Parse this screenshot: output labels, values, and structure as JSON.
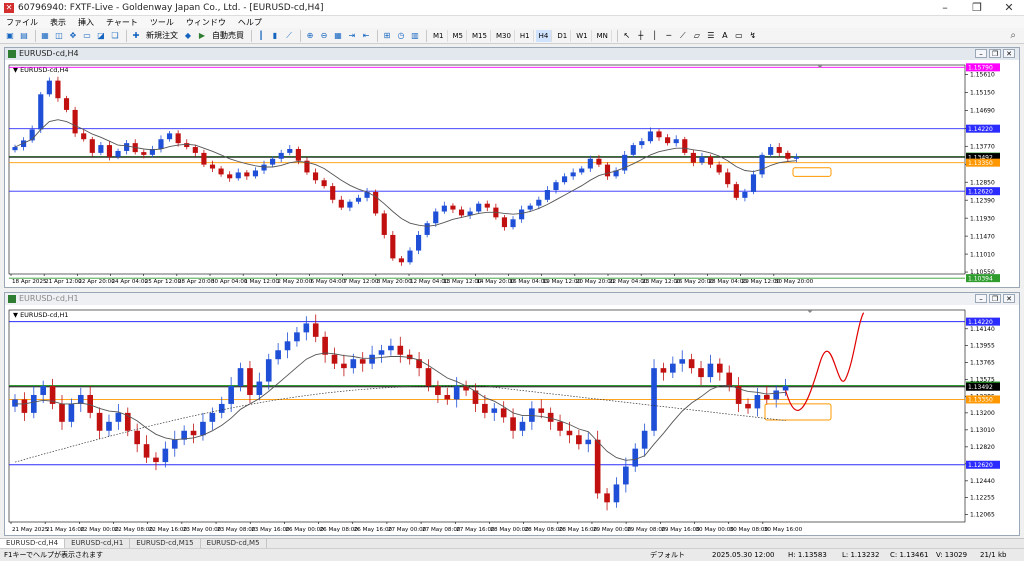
{
  "window": {
    "title": "60796940: FXTF-Live - Goldenway Japan Co., Ltd. - [EURUSD-cd,H4]"
  },
  "menu": [
    "ファイル",
    "表示",
    "挿入",
    "チャート",
    "ツール",
    "ウィンドウ",
    "ヘルプ"
  ],
  "toolbar": {
    "new_order": "新規注文",
    "auto_trade": "自動売買",
    "timeframes": [
      "M1",
      "M5",
      "M15",
      "M30",
      "H1",
      "H4",
      "D1",
      "W1",
      "MN"
    ],
    "active_timeframe": "H4"
  },
  "chart_h4": {
    "window_title": "EURUSD-cd,H4",
    "label": "EURUSD-cd,H4",
    "chart_data": {
      "type": "candlestick",
      "symbol": "EURUSD-cd",
      "timeframe": "H4",
      "ylim": [
        1.105,
        1.1585
      ],
      "yticks": [
        1.1561,
        1.1515,
        1.1469,
        1.1423,
        1.1377,
        1.1331,
        1.1285,
        1.1239,
        1.1193,
        1.1147,
        1.1101,
        1.1055
      ],
      "xticks": [
        "18 Apr 2025",
        "21 Apr 12:00",
        "22 Apr 20:00",
        "24 Apr 04:00",
        "25 Apr 12:00",
        "28 Apr 20:00",
        "30 Apr 04:00",
        "1 May 12:00",
        "2 May 20:00",
        "6 May 04:00",
        "7 May 12:00",
        "8 May 20:00",
        "12 May 04:00",
        "13 May 12:00",
        "14 May 20:00",
        "16 May 04:00",
        "19 May 12:00",
        "20 May 20:00",
        "22 May 04:00",
        "23 May 12:00",
        "26 May 20:00",
        "28 May 04:00",
        "29 May 12:00",
        "30 May 20:00"
      ],
      "closes": [
        1.1375,
        1.1392,
        1.142,
        1.151,
        1.1545,
        1.15,
        1.147,
        1.141,
        1.1395,
        1.136,
        1.138,
        1.135,
        1.1365,
        1.1385,
        1.1362,
        1.1355,
        1.137,
        1.1395,
        1.141,
        1.1385,
        1.1375,
        1.136,
        1.133,
        1.132,
        1.1305,
        1.1295,
        1.131,
        1.13,
        1.1315,
        1.133,
        1.1345,
        1.136,
        1.137,
        1.134,
        1.131,
        1.129,
        1.1275,
        1.124,
        1.122,
        1.1235,
        1.1245,
        1.126,
        1.1205,
        1.115,
        1.109,
        1.108,
        1.111,
        1.115,
        1.118,
        1.121,
        1.1225,
        1.1215,
        1.12,
        1.121,
        1.123,
        1.122,
        1.1195,
        1.117,
        1.119,
        1.1215,
        1.1225,
        1.124,
        1.1265,
        1.1285,
        1.13,
        1.131,
        1.132,
        1.1345,
        1.133,
        1.13,
        1.1315,
        1.1355,
        1.138,
        1.139,
        1.1415,
        1.14,
        1.1385,
        1.1395,
        1.136,
        1.1335,
        1.135,
        1.133,
        1.131,
        1.128,
        1.1245,
        1.126,
        1.1305,
        1.1355,
        1.1375,
        1.136,
        1.1345,
        1.135
      ],
      "moving_average": [
        1.1375,
        1.1385,
        1.1395,
        1.142,
        1.144,
        1.1445,
        1.144,
        1.143,
        1.142,
        1.1408,
        1.14,
        1.139,
        1.138,
        1.1378,
        1.1374,
        1.137,
        1.1368,
        1.137,
        1.1376,
        1.138,
        1.1382,
        1.138,
        1.1372,
        1.1364,
        1.1355,
        1.1345,
        1.1338,
        1.1332,
        1.1327,
        1.1324,
        1.1324,
        1.1328,
        1.1335,
        1.1338,
        1.1336,
        1.133,
        1.132,
        1.1305,
        1.129,
        1.1277,
        1.1267,
        1.126,
        1.1248,
        1.123,
        1.121,
        1.1192,
        1.118,
        1.1175,
        1.1172,
        1.1175,
        1.1182,
        1.119,
        1.1195,
        1.12,
        1.1205,
        1.1208,
        1.1208,
        1.1205,
        1.1203,
        1.1205,
        1.121,
        1.1218,
        1.1228,
        1.124,
        1.1252,
        1.1264,
        1.1276,
        1.129,
        1.1302,
        1.1308,
        1.1314,
        1.1322,
        1.1332,
        1.1343,
        1.1355,
        1.1363,
        1.1368,
        1.1372,
        1.1372,
        1.1368,
        1.1365,
        1.136,
        1.1352,
        1.134,
        1.1325,
        1.1315,
        1.1312,
        1.1318,
        1.1328,
        1.1335,
        1.1338,
        1.134
      ],
      "hlines": [
        {
          "value": 1.1579,
          "color": "#ff00ff",
          "label": "1.15790"
        },
        {
          "value": 1.1422,
          "color": "#2b2bff",
          "label": "1.14220"
        },
        {
          "value": 1.13506,
          "color": "#2e9d2e",
          "label": "1.13506"
        },
        {
          "value": 1.13492,
          "color": "#000000",
          "label": "1.13492"
        },
        {
          "value": 1.1335,
          "color": "#ff9800",
          "label": "1.13350"
        },
        {
          "value": 1.1262,
          "color": "#2b2bff",
          "label": "1.12620"
        },
        {
          "value": 1.10394,
          "color": "#2e9d2e",
          "label": "1.10394"
        }
      ],
      "colors": {
        "bull": "#1f4fd6",
        "bear": "#c01010",
        "ma": "#555555",
        "zone": "#ff9800"
      }
    }
  },
  "chart_h1": {
    "window_title": "EURUSD-cd,H1",
    "label": "EURUSD-cd,H1",
    "chart_data": {
      "type": "candlestick",
      "symbol": "EURUSD-cd",
      "timeframe": "H1",
      "ylim": [
        1.1198,
        1.1435
      ],
      "yticks": [
        1.1414,
        1.13955,
        1.13765,
        1.13575,
        1.13385,
        1.132,
        1.1301,
        1.1282,
        1.1263,
        1.1244,
        1.12255,
        1.12065
      ],
      "xticks": [
        "21 May 2025",
        "21 May 16:00",
        "22 May 00:00",
        "22 May 08:00",
        "22 May 16:00",
        "23 May 00:00",
        "23 May 08:00",
        "23 May 16:00",
        "26 May 00:00",
        "26 May 08:00",
        "26 May 16:00",
        "27 May 00:00",
        "27 May 08:00",
        "27 May 16:00",
        "28 May 00:00",
        "28 May 08:00",
        "28 May 16:00",
        "29 May 00:00",
        "29 May 08:00",
        "29 May 16:00",
        "30 May 00:00",
        "30 May 08:00",
        "30 May 16:00"
      ],
      "closes": [
        1.1335,
        1.132,
        1.134,
        1.135,
        1.133,
        1.131,
        1.133,
        1.134,
        1.132,
        1.13,
        1.131,
        1.132,
        1.13,
        1.1285,
        1.127,
        1.1265,
        1.128,
        1.129,
        1.13,
        1.1295,
        1.131,
        1.132,
        1.133,
        1.135,
        1.137,
        1.134,
        1.1355,
        1.138,
        1.139,
        1.14,
        1.141,
        1.142,
        1.1405,
        1.1385,
        1.1375,
        1.137,
        1.138,
        1.1375,
        1.1385,
        1.139,
        1.1395,
        1.1385,
        1.138,
        1.137,
        1.135,
        1.134,
        1.1335,
        1.135,
        1.1345,
        1.133,
        1.132,
        1.1325,
        1.1315,
        1.13,
        1.131,
        1.1325,
        1.132,
        1.131,
        1.13,
        1.1295,
        1.1285,
        1.129,
        1.123,
        1.122,
        1.124,
        1.126,
        1.128,
        1.13,
        1.137,
        1.1365,
        1.1375,
        1.138,
        1.137,
        1.136,
        1.1375,
        1.1365,
        1.135,
        1.133,
        1.1325,
        1.134,
        1.1335,
        1.1345,
        1.135
      ],
      "moving_average": [
        1.133,
        1.133,
        1.1332,
        1.1334,
        1.1333,
        1.133,
        1.133,
        1.1331,
        1.1329,
        1.1325,
        1.1322,
        1.1321,
        1.1317,
        1.1311,
        1.1303,
        1.1296,
        1.1292,
        1.129,
        1.1291,
        1.1292,
        1.1295,
        1.13,
        1.1306,
        1.1314,
        1.1324,
        1.133,
        1.1336,
        1.1344,
        1.1353,
        1.1362,
        1.1371,
        1.138,
        1.1385,
        1.1387,
        1.1386,
        1.1384,
        1.1383,
        1.1381,
        1.1381,
        1.1382,
        1.1383,
        1.1383,
        1.1382,
        1.1379,
        1.1373,
        1.1366,
        1.1359,
        1.1355,
        1.135,
        1.1344,
        1.1337,
        1.1333,
        1.1327,
        1.132,
        1.1317,
        1.1317,
        1.1316,
        1.1314,
        1.1311,
        1.1307,
        1.1302,
        1.1299,
        1.1288,
        1.1277,
        1.127,
        1.1267,
        1.1268,
        1.1272,
        1.1285,
        1.1297,
        1.131,
        1.1322,
        1.1331,
        1.1338,
        1.1346,
        1.135,
        1.1351,
        1.1347,
        1.1344,
        1.1343,
        1.1341,
        1.1342,
        1.1343
      ],
      "hlines": [
        {
          "value": 1.1422,
          "color": "#2b2bff",
          "label": "1.14220"
        },
        {
          "value": 1.13506,
          "color": "#2e9d2e",
          "label": "1.13506"
        },
        {
          "value": 1.13492,
          "color": "#000000",
          "label": "1.13492"
        },
        {
          "value": 1.1335,
          "color": "#ff9800",
          "label": "1.13350"
        },
        {
          "value": 1.1262,
          "color": "#2b2bff",
          "label": "1.12620"
        }
      ],
      "colors": {
        "bull": "#1f4fd6",
        "bear": "#c01010",
        "ma": "#555555",
        "zone": "#ff9800",
        "scenario": "#e00000"
      }
    }
  },
  "tabs": [
    "EURUSD-cd,H4",
    "EURUSD-cd,H1",
    "EURUSD-cd,M15",
    "EURUSD-cd,M5"
  ],
  "active_tab": "EURUSD-cd,H4",
  "status": {
    "help": "F1キーでヘルプが表示されます",
    "profile": "デフォルト",
    "datetime": "2025.05.30 12:00",
    "high": "H: 1.13583",
    "low": "L: 1.13232",
    "close": "C: 1.13461",
    "volume": "V: 13029",
    "bytes": "21/1 kb"
  }
}
